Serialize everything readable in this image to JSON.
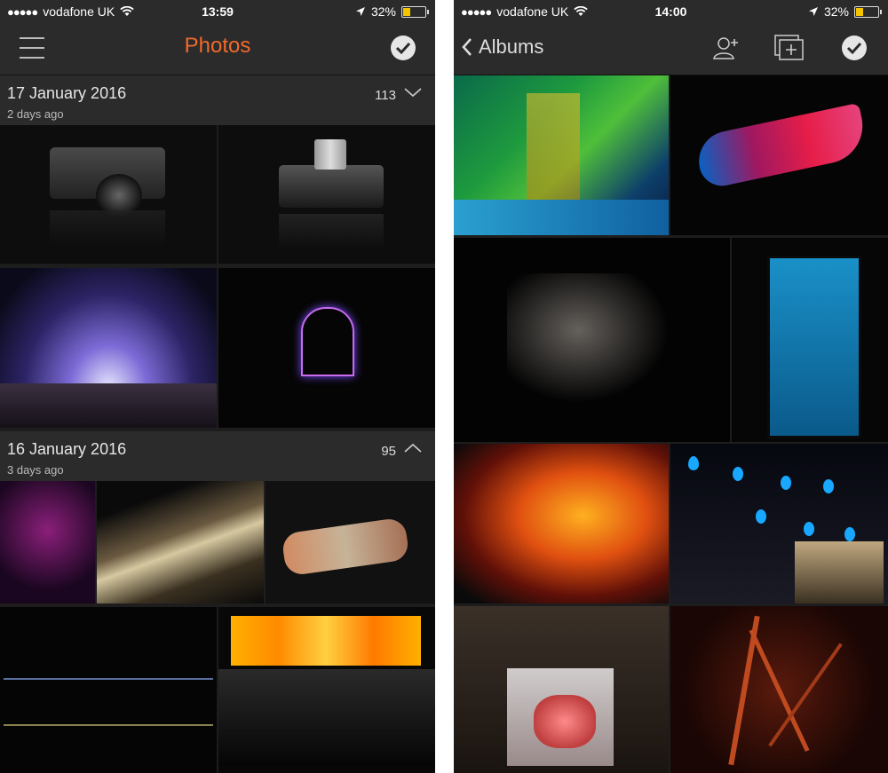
{
  "left_screen": {
    "status": {
      "carrier": "vodafone UK",
      "time": "13:59",
      "battery": "32%",
      "battery_level": 0.32
    },
    "nav": {
      "title": "Photos"
    },
    "sections": [
      {
        "date": "17 January 2016",
        "ago": "2 days ago",
        "count": "113"
      },
      {
        "date": "16 January 2016",
        "ago": "3 days ago",
        "count": "95"
      }
    ]
  },
  "right_screen": {
    "status": {
      "carrier": "vodafone UK",
      "time": "14:00",
      "battery": "32%",
      "battery_level": 0.32
    },
    "nav": {
      "back_label": "Albums"
    }
  },
  "colors": {
    "accent": "#f26a2b",
    "bar_bg": "#2b2b2b",
    "content_bg": "#1d1d1d",
    "battery": "#f5c400"
  },
  "icons": [
    "menu-icon",
    "check-circle-icon",
    "chevron-down-icon",
    "chevron-up-icon",
    "chevron-left-icon",
    "add-person-icon",
    "add-album-icon",
    "wifi-icon",
    "location-arrow-icon",
    "battery-icon"
  ]
}
